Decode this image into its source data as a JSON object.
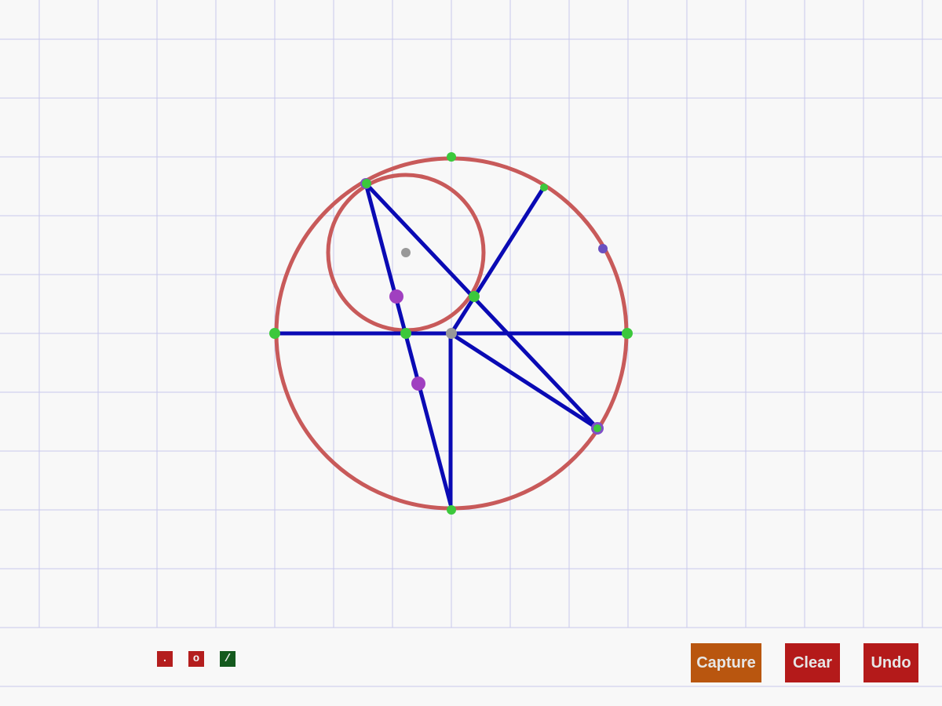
{
  "toolbar": {
    "point_tool_label": ".",
    "circle_tool_label": "o",
    "line_tool_label": "/"
  },
  "actions": {
    "capture_label": "Capture",
    "clear_label": "Clear",
    "undo_label": "Undo"
  },
  "colors": {
    "background": "#f8f8f8",
    "grid": "#c8c8ec",
    "circle_stroke": "#c85a5a",
    "line_stroke": "#0a0ab4",
    "point_green": "#3cc83c",
    "point_purple": "#a040c0",
    "point_gray": "#999999",
    "point_tool_bg": "#b41e1e",
    "circle_tool_bg": "#b41e1e",
    "line_tool_bg": "#145a1e",
    "capture_bg": "#b9560f",
    "clear_bg": "#b41a1a",
    "undo_bg": "#b41a1a"
  }
}
